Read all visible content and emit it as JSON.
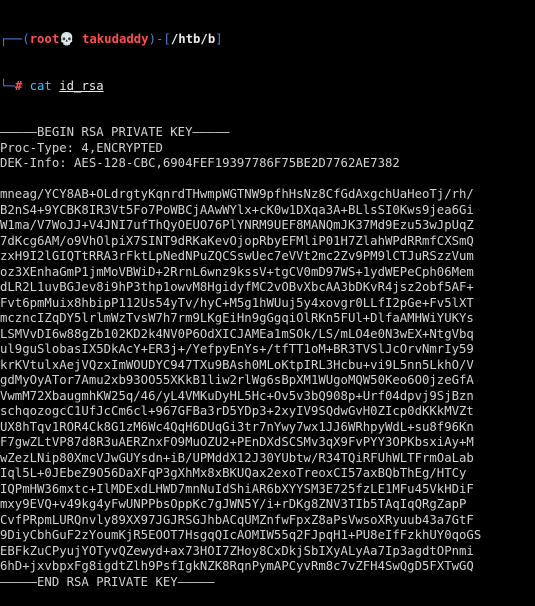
{
  "prompt": {
    "corner_top": "┌──(",
    "user_host": "root💀 takudaddy",
    "sep": ")-[",
    "path": "/htb/b",
    "close": "]",
    "corner_bottom": "└─",
    "hash": "# ",
    "command": "cat",
    "argument": "id_rsa"
  },
  "output": {
    "lines": [
      "—————BEGIN RSA PRIVATE KEY—————",
      "Proc-Type: 4,ENCRYPTED",
      "DEK-Info: AES-128-CBC,6904FEF19397786F75BE2D7762AE7382",
      "",
      "mneag/YCY8AB+OLdrgtyKqnrdTHwmpWGTNW9pfhHsNz8CfGdAxgchUaHeoTj/rh/",
      "B2nS4+9YCBK8IR3Vt5Fo7PoWBCjAAwWYlx+cK0w1DXqa3A+BLlsSI0Kws9jea6Gi",
      "W1ma/V7WoJJ+V4JNI7ufThQyOEUO76PlYNRM9UEF8MANQmJK37Md9Ezu53wJpUqZ",
      "7dKcg6AM/o9VhOlpiX7SINT9dRKaKevOjopRbyEFMliP01H7ZlahWPdRRmfCXSmQ",
      "zxH9I2lGIQTtRRA3rFktLpNedNPuZQCSswUec7eVVt2mc2Zv9PM9lCTJuRSzzVum",
      "oz3XEnhaGmP1jmMoVBWiD+2RrnL6wnz9kssV+tgCV0mD97WS+1ydWEPeCph06Mem",
      "dLR2L1uvBGJev8i9hP3thp1owvM8HgidyfMC2vOBvXbcAA3bDKvR4jsz2obf5AF+",
      "Fvt6pmMuix8hbipP112Us54yTv/hyC+M5g1hWUuj5y4xovgr0LLfI2pGe+Fv5lXT",
      "mczncIZqDY5lrlmWzTvsW7h7rm9LKgEiHn9gGgqiOlRKn5FUl+DlfaAMHWiYUKYs",
      "LSMVvDI6w88gZb102KD2k4NV0P6OdXICJAMEa1mSOk/LS/mLO4e0N3wEX+NtgVbq",
      "ul9guSlobasIX5DkAcY+ER3j+/YefpyEnYs+/tfTT1oM+BR3TVSlJcOrvNmrIy59",
      "krKVtulxAejVQzxImWOUDYC947TXu9BAsh0MLoKtpIRL3Hcbu+vi9L5nn5LkhO/V",
      "gdMyOyATor7Amu2xb93OO55XKkB1liw2rlWg6sBpXM1WUgoMQW50Keo6O0jzeGfA",
      "VwmM72XbaugmhKW25q/46/yL4VMKuDyHL5Hc+Ov5v3bQ908p+Urf04dpvj9SjBzn",
      "schqozogcC1UfJcCm6cl+967GFBa3rD5YDp3+2xyIV9SQdwGvH0ZIcp0dKKkMVZt",
      "UX8hTqv1ROR4Ck8G1zM6Wc4QqH6DUqGi3tr7nYwy7wx1JJ6WRhpyWdL+su8f96Kn",
      "F7gwZLtVP87d8R3uAERZnxFO9MuOZU2+PEnDXdSCSMv3qX9FvPYY3OPKbsxiAy+M",
      "wZezLNip80XmcVJwGUYsdn+iB/UPMddX12J30YUbtw/R34TQiRFUhWLTFrmOaLab",
      "Iql5L+0JEbeZ9O56DaXFqP3gXhMx8xBKUQax2exoTreoxCI57axBQbThEg/HTCy",
      "IQPmHW36mxtc+IlMDExdLHWD7mnNuIdShiAR6bXYYSM3E725fzLE1MFu45VkHDiF",
      "mxy9EVQ+v49kg4yFwUNPPbsOppKc7gJWN5Y/i+rDKg8ZNV3TIb5TAqIqQRgZapP",
      "CvfPRpmLURQnvly89XX97JGJRSGJhbACqUMZnfwFpxZ8aPsVwsoXRyuub43a7GtF",
      "9DiyCbhGuF2zYoumKjR5EOOT7HsgqQIcAOMIW55q2FJpqH1+PU8eIfFzkhUY0qoGS",
      "EBFkZuCPyujYOTyvQZewyd+ax73HOI7ZHoy8CxDkjSbIXyALyAa7Ip3agdtOPnmi",
      "6hD+jxvbpxFg8igdtZlh9PsfIgkNZK8RqnPymAPCyvRm8c7vZFH4SwQgD5FXTwGQ",
      "—————END RSA PRIVATE KEY—————"
    ]
  },
  "colors": {
    "background": "#000000",
    "frame": "#4a7fd8",
    "user": "#ff4d4d",
    "path": "#e9e9e9",
    "command": "#33c4ff",
    "text": "#d2d2d2"
  }
}
